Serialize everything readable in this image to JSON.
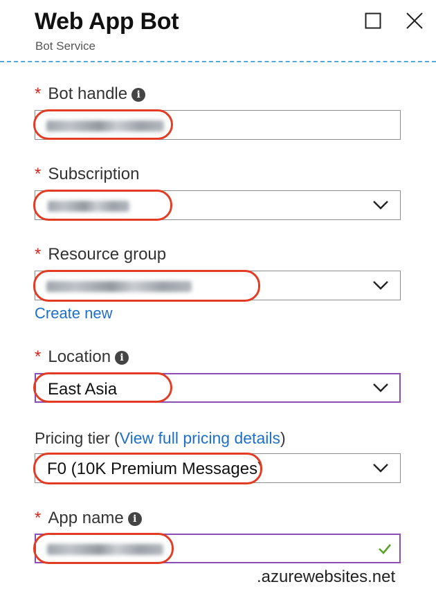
{
  "header": {
    "title": "Web App Bot",
    "subtitle": "Bot Service"
  },
  "form": {
    "bot_handle": {
      "label": "Bot handle",
      "required": "*"
    },
    "subscription": {
      "label": "Subscription",
      "required": "*"
    },
    "resource_group": {
      "label": "Resource group",
      "required": "*",
      "create_new": "Create new"
    },
    "location": {
      "label": "Location",
      "required": "*",
      "value": "East Asia"
    },
    "pricing_tier": {
      "label_prefix": "Pricing tier (",
      "link": "View full pricing details",
      "label_suffix": ")",
      "value": "F0 (10K Premium Messages)"
    },
    "app_name": {
      "label": "App name",
      "required": "*",
      "suffix": ".azurewebsites.net"
    }
  },
  "colors": {
    "required": "#d9261c",
    "link": "#1e6fcc",
    "focus_border": "#8a4fb4",
    "annotation": "#e33b24",
    "valid_check": "#5aa22a",
    "divider": "#52a8d8"
  },
  "icons": {
    "maximize": "maximize-icon",
    "close": "close-icon",
    "info": "info-icon",
    "dropdown": "chevron-down-icon",
    "valid": "checkmark-icon"
  }
}
